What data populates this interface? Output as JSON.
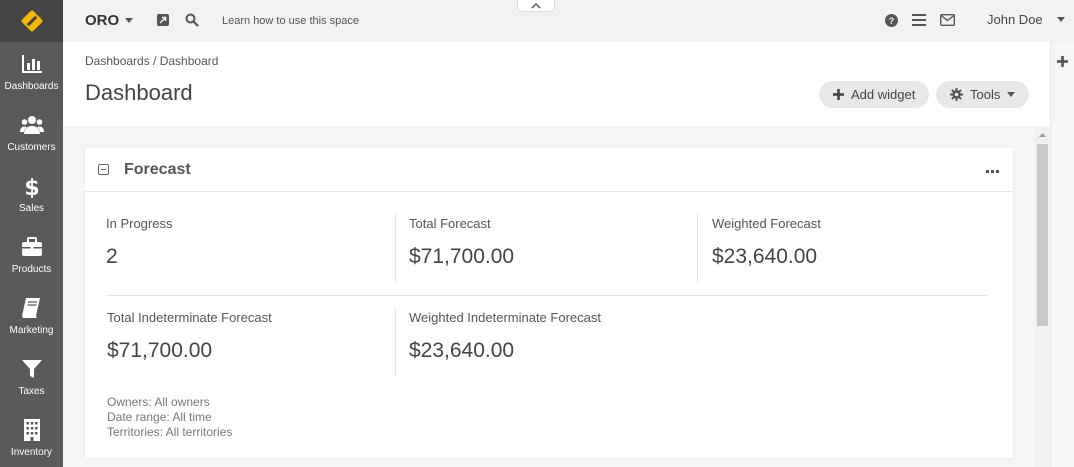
{
  "sidebar": {
    "items": [
      {
        "label": "Dashboards",
        "icon": "bar-chart-icon"
      },
      {
        "label": "Customers",
        "icon": "users-icon"
      },
      {
        "label": "Sales",
        "icon": "dollar-icon"
      },
      {
        "label": "Products",
        "icon": "briefcase-icon"
      },
      {
        "label": "Marketing",
        "icon": "book-icon"
      },
      {
        "label": "Taxes",
        "icon": "filter-icon"
      },
      {
        "label": "Inventory",
        "icon": "building-icon"
      }
    ]
  },
  "topbar": {
    "brand": "ORO",
    "learn_link": "Learn how to use this space",
    "user_name": "John Doe"
  },
  "page": {
    "breadcrumb": "Dashboards / Dashboard",
    "title": "Dashboard",
    "add_widget_label": "Add widget",
    "tools_label": "Tools"
  },
  "widget": {
    "title": "Forecast",
    "metrics": [
      {
        "label": "In Progress",
        "value": "2"
      },
      {
        "label": "Total Forecast",
        "value": "$71,700.00"
      },
      {
        "label": "Weighted Forecast",
        "value": "$23,640.00"
      },
      {
        "label": "Total Indeterminate Forecast",
        "value": "$71,700.00"
      },
      {
        "label": "Weighted Indeterminate Forecast",
        "value": "$23,640.00"
      }
    ],
    "filters": {
      "owners": "Owners: All owners",
      "date_range": "Date range: All time",
      "territories": "Territories: All territories"
    }
  },
  "colors": {
    "sidebar_bg": "#5a5a5a",
    "logo_bg": "#444444",
    "logo_accent": "#f5b700",
    "topbar_bg": "#f2f2f2"
  }
}
